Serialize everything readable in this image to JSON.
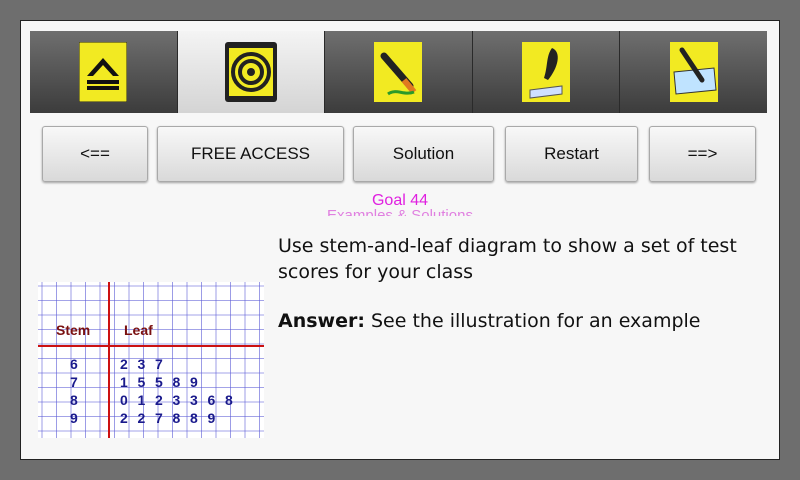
{
  "tabs": [
    {
      "icon": "home-icon",
      "active": false
    },
    {
      "icon": "target-icon",
      "active": true
    },
    {
      "icon": "pencil-icon",
      "active": false
    },
    {
      "icon": "quill-icon",
      "active": false
    },
    {
      "icon": "pen-paper-icon",
      "active": false
    }
  ],
  "buttons": {
    "prev": "<==",
    "free_access": "FREE ACCESS",
    "solution": "Solution",
    "restart": "Restart",
    "next": "==>"
  },
  "goal_label": "Goal 44",
  "ghost_heading": "Examples & Solutions",
  "question": "Use stem-and-leaf diagram to show a set of test scores for your class",
  "answer": {
    "label": "Answer:",
    "text": " See the illustration for an example"
  },
  "stem_leaf": {
    "headers": {
      "stem": "Stem",
      "leaf": "Leaf"
    },
    "rows": [
      {
        "stem": "6",
        "leaves": [
          "2",
          "3",
          "7"
        ]
      },
      {
        "stem": "7",
        "leaves": [
          "1",
          "5",
          "5",
          "8",
          "9"
        ]
      },
      {
        "stem": "8",
        "leaves": [
          "0",
          "1",
          "2",
          "3",
          "3",
          "6",
          "8"
        ]
      },
      {
        "stem": "9",
        "leaves": [
          "2",
          "2",
          "7",
          "8",
          "8",
          "9"
        ]
      }
    ]
  },
  "colors": {
    "tab_icon_bg": "#f2ea22",
    "goal": "#e020e0",
    "grid": "#5b5bd6",
    "red_line": "#cc1111",
    "header_text": "#7a1010",
    "digit_text": "#1a1a8c"
  }
}
